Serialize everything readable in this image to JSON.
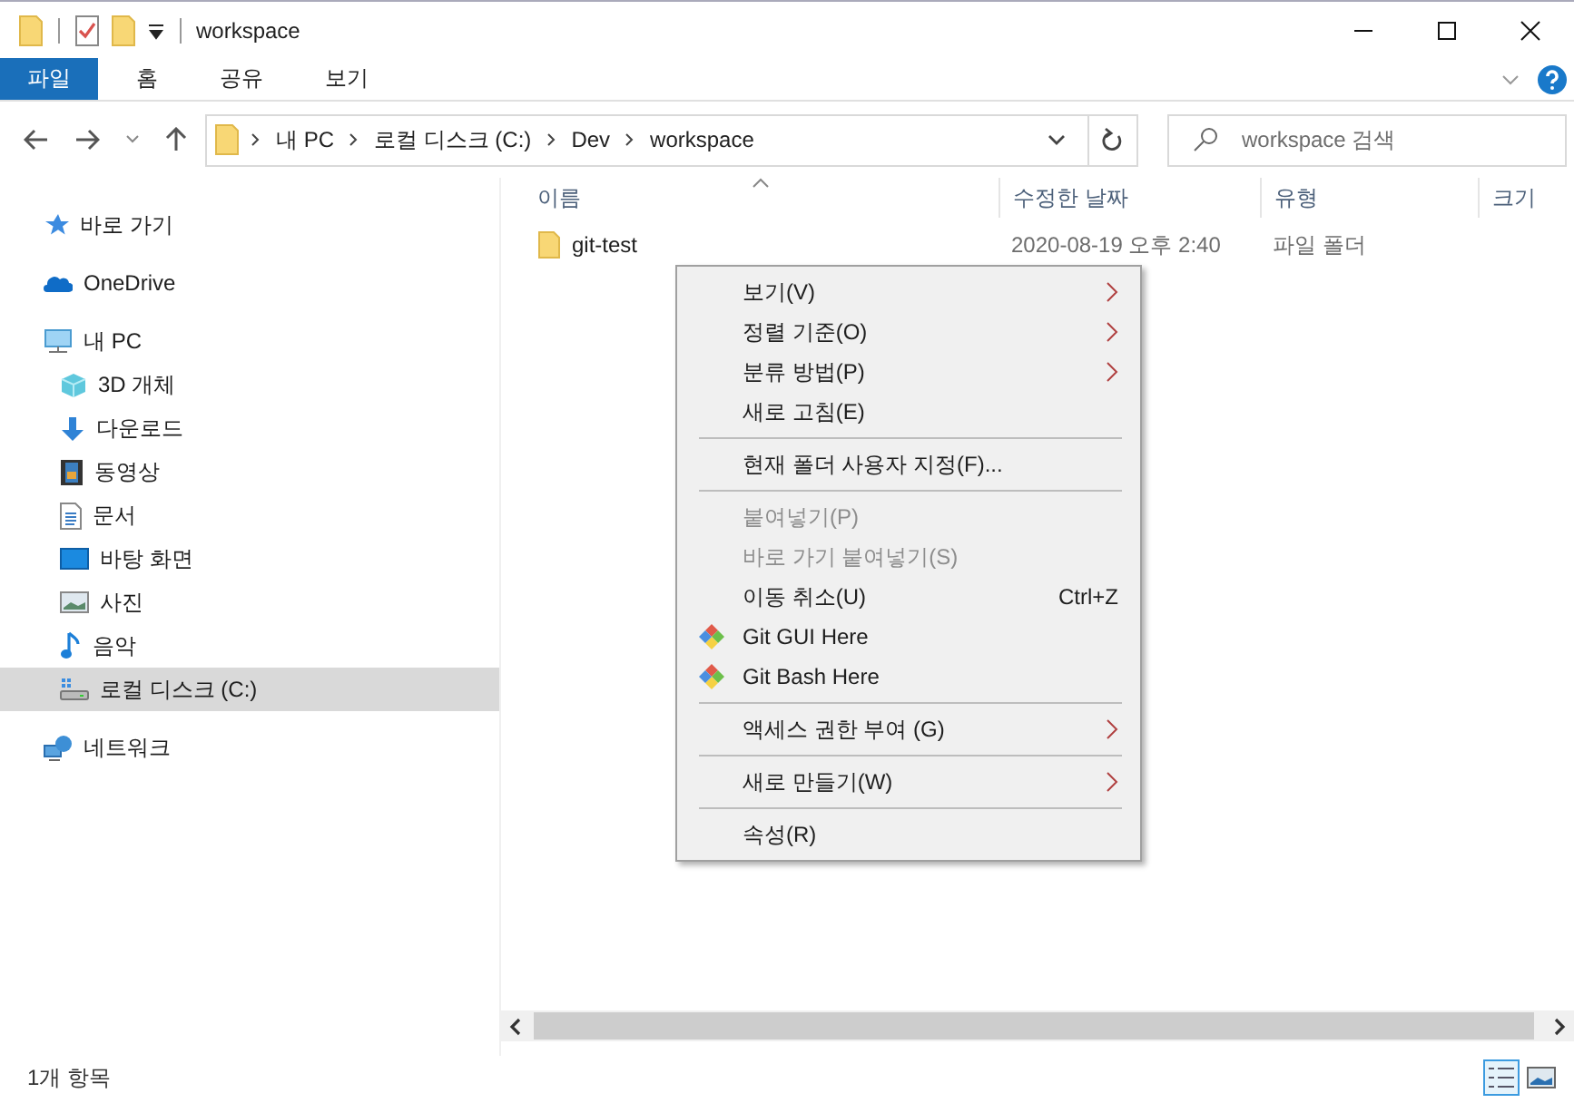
{
  "window": {
    "title": "workspace"
  },
  "ribbon_tabs": [
    {
      "label": "파일",
      "selected": true
    },
    {
      "label": "홈",
      "selected": false
    },
    {
      "label": "공유",
      "selected": false
    },
    {
      "label": "보기",
      "selected": false
    }
  ],
  "address_bar": {
    "crumbs": [
      "내 PC",
      "로컬 디스크 (C:)",
      "Dev",
      "workspace"
    ]
  },
  "search": {
    "placeholder": "workspace 검색"
  },
  "sidebar": {
    "items": [
      {
        "label": "바로 가기",
        "kind": "quick",
        "selected": false
      },
      {
        "label": "OneDrive",
        "kind": "cloud",
        "selected": false
      },
      {
        "label": "내 PC",
        "kind": "pc",
        "selected": false,
        "children": [
          {
            "label": "3D 개체",
            "kind": "cube",
            "selected": false
          },
          {
            "label": "다운로드",
            "kind": "download",
            "selected": false
          },
          {
            "label": "동영상",
            "kind": "video",
            "selected": false
          },
          {
            "label": "문서",
            "kind": "document",
            "selected": false
          },
          {
            "label": "바탕 화면",
            "kind": "desktop",
            "selected": false
          },
          {
            "label": "사진",
            "kind": "photo",
            "selected": false
          },
          {
            "label": "음악",
            "kind": "music",
            "selected": false
          },
          {
            "label": "로컬 디스크 (C:)",
            "kind": "drive",
            "selected": true
          }
        ]
      },
      {
        "label": "네트워크",
        "kind": "network",
        "selected": false
      }
    ]
  },
  "table": {
    "columns": [
      "이름",
      "수정한 날짜",
      "유형",
      "크기"
    ],
    "rows": [
      {
        "name": "git-test",
        "modified": "2020-08-19 오후 2:40",
        "type": "파일 폴더"
      }
    ]
  },
  "context_menu": {
    "items": [
      {
        "kind": "item",
        "label": "보기(V)",
        "submenu": true,
        "disabled": false
      },
      {
        "kind": "item",
        "label": "정렬 기준(O)",
        "submenu": true,
        "disabled": false
      },
      {
        "kind": "item",
        "label": "분류 방법(P)",
        "submenu": true,
        "disabled": false
      },
      {
        "kind": "item",
        "label": "새로 고침(E)",
        "submenu": false,
        "disabled": false
      },
      {
        "kind": "separator"
      },
      {
        "kind": "item",
        "label": "현재 폴더 사용자 지정(F)...",
        "submenu": false,
        "disabled": false
      },
      {
        "kind": "separator"
      },
      {
        "kind": "item",
        "label": "붙여넣기(P)",
        "submenu": false,
        "disabled": true
      },
      {
        "kind": "item",
        "label": "바로 가기 붙여넣기(S)",
        "submenu": false,
        "disabled": true
      },
      {
        "kind": "item",
        "label": "이동 취소(U)",
        "shortcut": "Ctrl+Z",
        "submenu": false,
        "disabled": false
      },
      {
        "kind": "git",
        "label": "Git GUI Here",
        "submenu": false,
        "disabled": false
      },
      {
        "kind": "git",
        "label": "Git Bash Here",
        "submenu": false,
        "disabled": false
      },
      {
        "kind": "separator"
      },
      {
        "kind": "item",
        "label": "액세스 권한 부여 (G)",
        "submenu": true,
        "disabled": false
      },
      {
        "kind": "separator"
      },
      {
        "kind": "item",
        "label": "새로 만들기(W)",
        "submenu": true,
        "disabled": false
      },
      {
        "kind": "separator"
      },
      {
        "kind": "item",
        "label": "속성(R)",
        "submenu": false,
        "disabled": false
      }
    ]
  },
  "status_bar": {
    "text": "1개 항목"
  }
}
